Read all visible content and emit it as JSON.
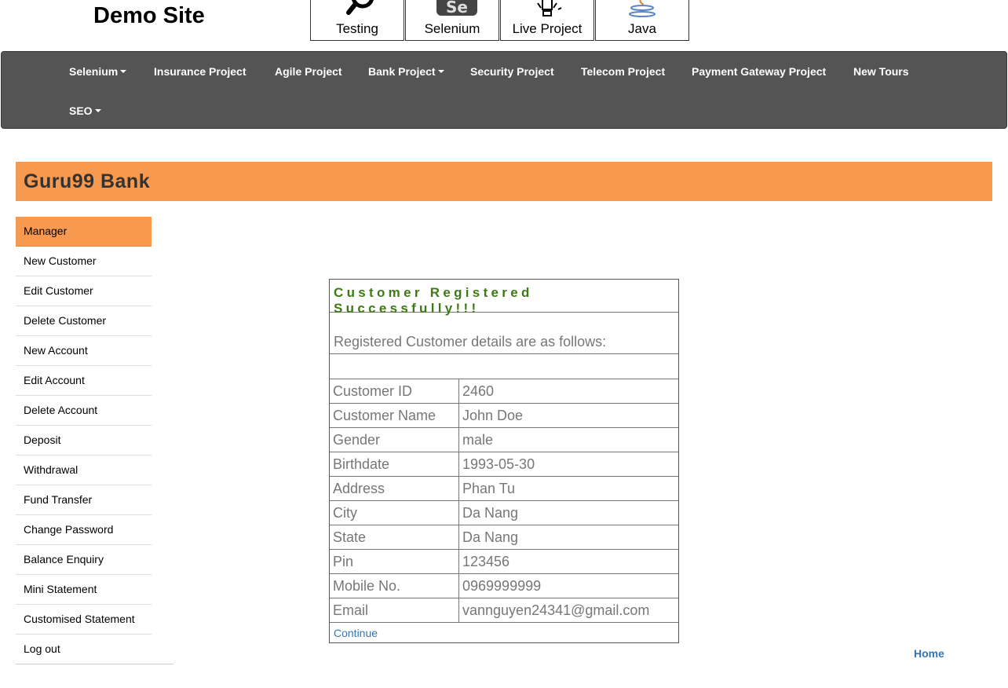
{
  "site": {
    "title": "Demo Site"
  },
  "logos": [
    {
      "label": "Testing",
      "icon": "magnifier-icon"
    },
    {
      "label": "Selenium",
      "icon": "selenium-icon"
    },
    {
      "label": "Live Project",
      "icon": "lightbulb-icon"
    },
    {
      "label": "Java",
      "icon": "java-icon"
    }
  ],
  "nav": {
    "items": [
      {
        "label": "Selenium",
        "dropdown": true
      },
      {
        "label": "Insurance Project",
        "dropdown": false
      },
      {
        "label": "Agile Project",
        "dropdown": false
      },
      {
        "label": "Bank Project",
        "dropdown": true
      },
      {
        "label": "Security Project",
        "dropdown": false
      },
      {
        "label": "Telecom Project",
        "dropdown": false
      },
      {
        "label": "Payment Gateway Project",
        "dropdown": false
      },
      {
        "label": "New Tours",
        "dropdown": false
      },
      {
        "label": "SEO",
        "dropdown": true
      }
    ]
  },
  "bank": {
    "title": "Guru99 Bank"
  },
  "menu": {
    "items": [
      "Manager",
      "New Customer",
      "Edit Customer",
      "Delete Customer",
      "New Account",
      "Edit Account",
      "Delete Account",
      "Deposit",
      "Withdrawal",
      "Fund Transfer",
      "Change Password",
      "Balance Enquiry",
      "Mini Statement",
      "Customised Statement",
      "Log out"
    ]
  },
  "result": {
    "success": "Customer Registered Successfully!!!",
    "details_heading": "Registered Customer details are as follows:",
    "rows": [
      {
        "label": "Customer ID",
        "value": "2460"
      },
      {
        "label": "Customer Name",
        "value": "John Doe"
      },
      {
        "label": "Gender",
        "value": "male"
      },
      {
        "label": "Birthdate",
        "value": "1993-05-30"
      },
      {
        "label": "Address",
        "value": "Phan Tu"
      },
      {
        "label": "City",
        "value": "Da Nang"
      },
      {
        "label": "State",
        "value": "Da Nang"
      },
      {
        "label": "Pin",
        "value": "123456"
      },
      {
        "label": "Mobile No.",
        "value": "0969999999"
      },
      {
        "label": "Email",
        "value": "vannguyen24341@gmail.com"
      }
    ],
    "continue_label": "Continue"
  },
  "footer": {
    "home_label": "Home"
  },
  "colors": {
    "accent": "#f79a50",
    "navbar": "#545454",
    "success": "#3d7a16",
    "link": "#3476b4"
  }
}
